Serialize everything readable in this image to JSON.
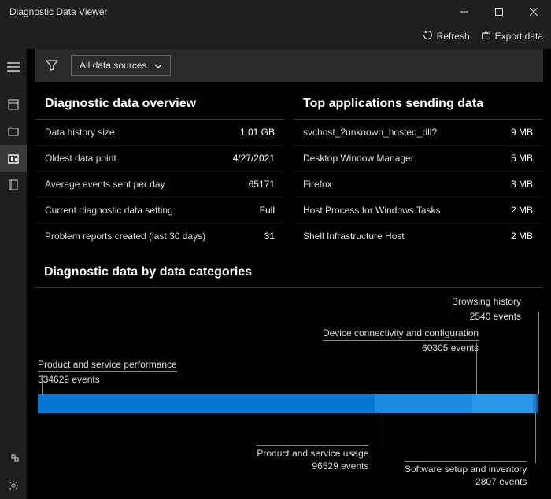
{
  "titlebar": {
    "title": "Diagnostic Data Viewer"
  },
  "commandbar": {
    "refresh_label": "Refresh",
    "export_label": "Export data"
  },
  "filter": {
    "dropdown_label": "All data sources"
  },
  "overview": {
    "title": "Diagnostic data overview",
    "rows": [
      {
        "label": "Data history size",
        "value": "1.01 GB"
      },
      {
        "label": "Oldest data point",
        "value": "4/27/2021"
      },
      {
        "label": "Average events sent per day",
        "value": "65171"
      },
      {
        "label": "Current diagnostic data setting",
        "value": "Full"
      },
      {
        "label": "Problem reports created (last 30 days)",
        "value": "31"
      }
    ]
  },
  "topapps": {
    "title": "Top applications sending data",
    "rows": [
      {
        "label": "svchost_?unknown_hosted_dll?",
        "value": "9 MB"
      },
      {
        "label": "Desktop Window Manager",
        "value": "5 MB"
      },
      {
        "label": "Firefox",
        "value": "3 MB"
      },
      {
        "label": "Host Process for Windows Tasks",
        "value": "2 MB"
      },
      {
        "label": "Shell Infrastructure Host",
        "value": "2 MB"
      }
    ]
  },
  "categories": {
    "title": "Diagnostic data by data categories"
  },
  "chart_data": {
    "type": "bar",
    "categories": [
      "Product and service performance",
      "Product and service usage",
      "Device connectivity and configuration",
      "Software setup and inventory",
      "Browsing history"
    ],
    "values": [
      334629,
      96529,
      60305,
      2807,
      2540
    ],
    "events_suffix": " events"
  }
}
